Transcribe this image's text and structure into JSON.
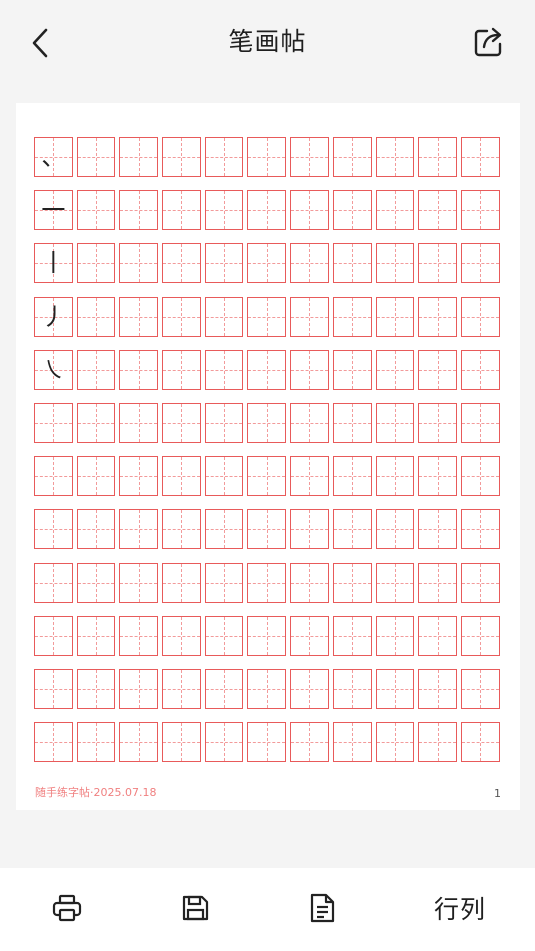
{
  "header": {
    "title": "笔画帖"
  },
  "sheet": {
    "strokes": [
      "、",
      "一",
      "丨",
      "丿",
      "㇏"
    ],
    "footer_text": "随手练字帖·2025.07.18",
    "page_number": "1"
  },
  "toolbar": {
    "rowcol_label": "行列"
  },
  "colors": {
    "grid_line": "#e85a5a",
    "grid_dash": "#f29a9a",
    "footer_text": "#f08080"
  }
}
